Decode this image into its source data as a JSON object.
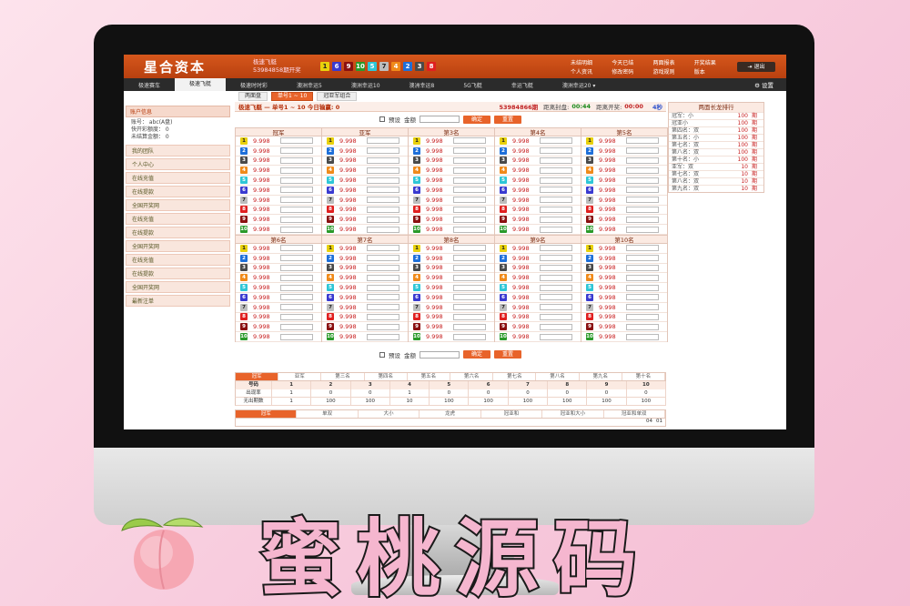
{
  "app": {
    "brand": "星合资本",
    "game_name": "极速飞艇",
    "issue_text": "53984858期开奖",
    "draw_balls": [
      "1",
      "6",
      "9",
      "10",
      "5",
      "7",
      "4",
      "2",
      "3",
      "8"
    ],
    "top_links": [
      "未结明细",
      "今天已结",
      "两面报表",
      "开奖结果",
      "个人资讯",
      "修改密码",
      "游戏规则",
      "版本"
    ],
    "logout": "退出"
  },
  "nav": {
    "items": [
      "极速赛车",
      "极速飞艇",
      "极速时时彩",
      "澳洲幸运5",
      "澳洲幸运10",
      "澳洲幸运8",
      "5G飞艇",
      "幸运飞艇",
      "澳洲幸运20 ▾"
    ],
    "active_index": 1,
    "settings": "设置"
  },
  "subtabs": [
    "两面盘",
    "单号1 ~ 10",
    "冠亚军组合"
  ],
  "sidebar": {
    "account_title": "账户信息",
    "account_lines": [
      "账号：    abc(A盘)",
      "快开彩额度：    0",
      "未结算金额：    0"
    ],
    "items": [
      "我的团队",
      "个人中心",
      "在线充值",
      "在线提款",
      "全国开奖网",
      "在线充值",
      "在线提款",
      "全国开奖网",
      "在线充值",
      "在线提款",
      "全国开奖网",
      "最新注单"
    ]
  },
  "main": {
    "title": "极速飞艇 — 单号1 ~ 10  今日输赢: 0",
    "issue": "53984866期",
    "close_label": "距离封盘:",
    "close_time": "00:44",
    "open_label": "距离开奖:",
    "open_time": "00:00",
    "refresh": "4秒",
    "preset_label": "预设",
    "amount_label": "金额",
    "confirm": "确定",
    "reset": "重置",
    "odds": "9.998",
    "columns": [
      "冠军",
      "亚军",
      "第3名",
      "第4名",
      "第5名",
      "第6名",
      "第7名",
      "第8名",
      "第9名",
      "第10名"
    ],
    "numbers": [
      "1",
      "2",
      "3",
      "4",
      "5",
      "6",
      "7",
      "8",
      "9",
      "10"
    ]
  },
  "stats": {
    "tabs": [
      "冠军",
      "亚军",
      "第三名",
      "第四名",
      "第五名",
      "第六名",
      "第七名",
      "第八名",
      "第九名",
      "第十名"
    ],
    "row_labels": [
      "号码",
      "出现率",
      "无出期数"
    ],
    "numbers": [
      "1",
      "2",
      "3",
      "4",
      "5",
      "6",
      "7",
      "8",
      "9",
      "10"
    ],
    "appear": [
      "1",
      "0",
      "0",
      "1",
      "0",
      "0",
      "0",
      "0",
      "0",
      "0"
    ],
    "missing": [
      "1",
      "100",
      "100",
      "10",
      "100",
      "100",
      "100",
      "100",
      "100",
      "100"
    ],
    "tabs2": [
      "冠军",
      "单双",
      "大小",
      "龙虎",
      "冠亚和",
      "冠亚和大小",
      "冠亚和单双"
    ],
    "strip": [
      "04",
      "01"
    ]
  },
  "ranking": {
    "title": "两面长龙排行",
    "unit": "期",
    "rows": [
      {
        "name": "冠军：小",
        "value": "100"
      },
      {
        "name": "冠亚小",
        "value": "100"
      },
      {
        "name": "第四名：双",
        "value": "100"
      },
      {
        "name": "第五名：小",
        "value": "100"
      },
      {
        "name": "第七名：双",
        "value": "100"
      },
      {
        "name": "第八名：双",
        "value": "100"
      },
      {
        "name": "第十名：小",
        "value": "100"
      },
      {
        "name": "亚军：双",
        "value": "10"
      },
      {
        "name": "第七名：双",
        "value": "10"
      },
      {
        "name": "第八名：双",
        "value": "10"
      },
      {
        "name": "第九名：双",
        "value": "10"
      }
    ]
  },
  "decor": {
    "title": "蜜桃源码"
  },
  "colors": {
    "ball": [
      "#e9d10c",
      "#1e6fd9",
      "#4a4a4a",
      "#f08a1a",
      "#2ec6d6",
      "#3a3ad0",
      "#bdbdbd",
      "#e02020",
      "#8a1010",
      "#2a9a2a"
    ],
    "accent": "#e8632a",
    "header": "#c44a14"
  }
}
